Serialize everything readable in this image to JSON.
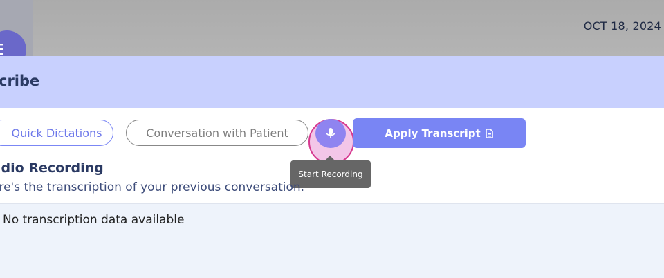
{
  "header": {
    "date": "OCT 18, 2024",
    "menu_icon": "hamburger-icon"
  },
  "panel": {
    "title": "cribe",
    "buttons": {
      "quick_dictations": "Quick Dictations",
      "conversation_with_patient": "Conversation with Patient",
      "apply_transcript": "Apply Transcript",
      "apply_icon": "document-icon",
      "mic_icon": "microphone-icon"
    },
    "tooltip": "Start Recording",
    "section": {
      "title": "udio Recording",
      "subtitle": "ere's the transcription of your previous conversation."
    },
    "transcript": {
      "empty_message": "No transcription data available"
    }
  },
  "colors": {
    "accent": "#7985f4",
    "header_bg": "#c8d0fe",
    "recording_ring": "#d6398f",
    "overlay": "#b3b3b3"
  }
}
